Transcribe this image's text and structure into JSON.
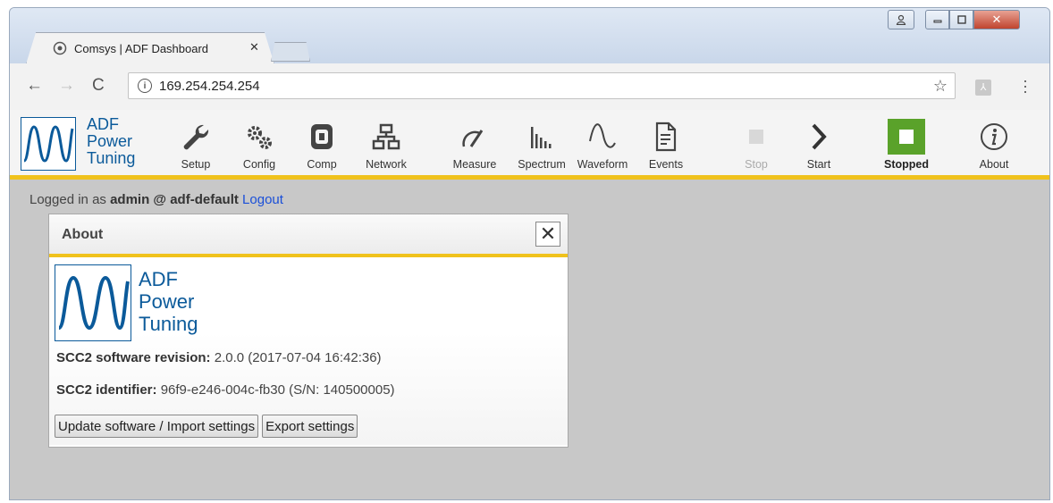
{
  "browser": {
    "tab_title": "Comsys | ADF Dashboard",
    "tab_close": "✕",
    "url": "169.254.254.254",
    "info_glyph": "i"
  },
  "app": {
    "logo_lines": [
      "ADF",
      "Power",
      "Tuning"
    ],
    "toolbar": [
      {
        "id": "setup",
        "label": "Setup",
        "icon": "wrench-icon"
      },
      {
        "id": "config",
        "label": "Config",
        "icon": "gears-icon"
      },
      {
        "id": "comp",
        "label": "Comp",
        "icon": "chip-icon"
      },
      {
        "id": "network",
        "label": "Network",
        "icon": "network-icon"
      },
      {
        "id": "measure",
        "label": "Measure",
        "icon": "gauge-icon"
      },
      {
        "id": "spectrum",
        "label": "Spectrum",
        "icon": "spectrum-icon"
      },
      {
        "id": "waveform",
        "label": "Waveform",
        "icon": "waveform-icon"
      },
      {
        "id": "events",
        "label": "Events",
        "icon": "document-icon"
      },
      {
        "id": "stop",
        "label": "Stop",
        "icon": "stop-square-icon",
        "disabled": true
      },
      {
        "id": "start",
        "label": "Start",
        "icon": "chevron-right-icon"
      },
      {
        "id": "stopped",
        "label": "Stopped",
        "icon": "status-square-icon"
      },
      {
        "id": "about",
        "label": "About",
        "icon": "info-circle-icon"
      }
    ],
    "colors": {
      "accent": "#f0c21c",
      "brand": "#0b5a9a",
      "status": "#5aa22a"
    }
  },
  "session": {
    "prefix": "Logged in as ",
    "user": "admin @ adf-default",
    "logout": "Logout"
  },
  "about": {
    "title": "About",
    "close": "✕",
    "revision_label": "SCC2 software revision:",
    "revision_value": "2.0.0 (2017-07-04 16:42:36)",
    "identifier_label": "SCC2 identifier:",
    "identifier_value": "96f9-e246-004c-fb30 (S/N: 140500005)",
    "update_button": "Update software / Import settings",
    "export_button": "Export settings"
  }
}
